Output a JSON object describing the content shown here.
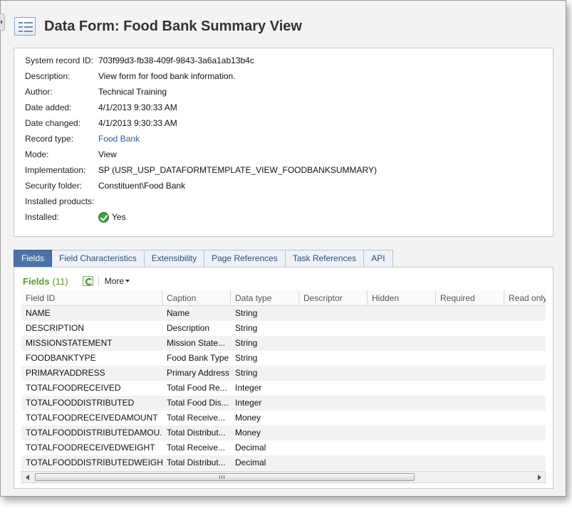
{
  "header": {
    "title": "Data Form: Food Bank Summary View",
    "icon": "form-icon"
  },
  "info": {
    "rows": [
      {
        "label": "System record ID:",
        "value": "703f99d3-fb38-409f-9843-3a6a1ab13b4c"
      },
      {
        "label": "Description:",
        "value": "View form for food bank information."
      },
      {
        "label": "Author:",
        "value": "Technical Training"
      },
      {
        "label": "Date added:",
        "value": "4/1/2013 9:30:33 AM"
      },
      {
        "label": "Date changed:",
        "value": "4/1/2013 9:30:33 AM"
      },
      {
        "label": "Record type:",
        "value": "Food Bank"
      },
      {
        "label": "Mode:",
        "value": "View"
      },
      {
        "label": "Implementation:",
        "value": "SP (USR_USP_DATAFORMTEMPLATE_VIEW_FOODBANKSUMMARY)"
      },
      {
        "label": "Security folder:",
        "value": "Constituent\\Food Bank"
      },
      {
        "label": "Installed products:",
        "value": ""
      },
      {
        "label": "Installed:",
        "value": "Yes"
      }
    ],
    "link_color": "#2f5f9a",
    "yes_color": "#1f7a25"
  },
  "tabs": [
    {
      "label": "Fields",
      "active": true
    },
    {
      "label": "Field Characteristics"
    },
    {
      "label": "Extensibility"
    },
    {
      "label": "Page References"
    },
    {
      "label": "Task References"
    },
    {
      "label": "API"
    }
  ],
  "fields": {
    "title": "Fields",
    "count": "(11)",
    "more_label": "More",
    "columns": [
      "Field ID",
      "Caption",
      "Data type",
      "Descriptor",
      "Hidden",
      "Required",
      "Read only"
    ],
    "rows": [
      [
        "NAME",
        "Name",
        "String"
      ],
      [
        "DESCRIPTION",
        "Description",
        "String"
      ],
      [
        "MISSIONSTATEMENT",
        "Mission State...",
        "String"
      ],
      [
        "FOODBANKTYPE",
        "Food Bank Type",
        "String"
      ],
      [
        "PRIMARYADDRESS",
        "Primary Address",
        "String"
      ],
      [
        "TOTALFOODRECEIVED",
        "Total Food Re...",
        "Integer"
      ],
      [
        "TOTALFOODDISTRIBUTED",
        "Total Food Dis...",
        "Integer"
      ],
      [
        "TOTALFOODRECEIVEDAMOUNT",
        "Total Receive...",
        "Money"
      ],
      [
        "TOTALFOODDISTRIBUTEDAMOU...",
        "Total Distribut...",
        "Money"
      ],
      [
        "TOTALFOODRECEIVEDWEIGHT",
        "Total Receive...",
        "Decimal"
      ],
      [
        "TOTALFOODDISTRIBUTEDWEIGHT",
        "Total Distribut...",
        "Decimal"
      ]
    ],
    "accent_color": "#5a9a2a"
  },
  "colors": {
    "active_tab": "#4a72a8",
    "tab_text": "#2c4f7c"
  }
}
